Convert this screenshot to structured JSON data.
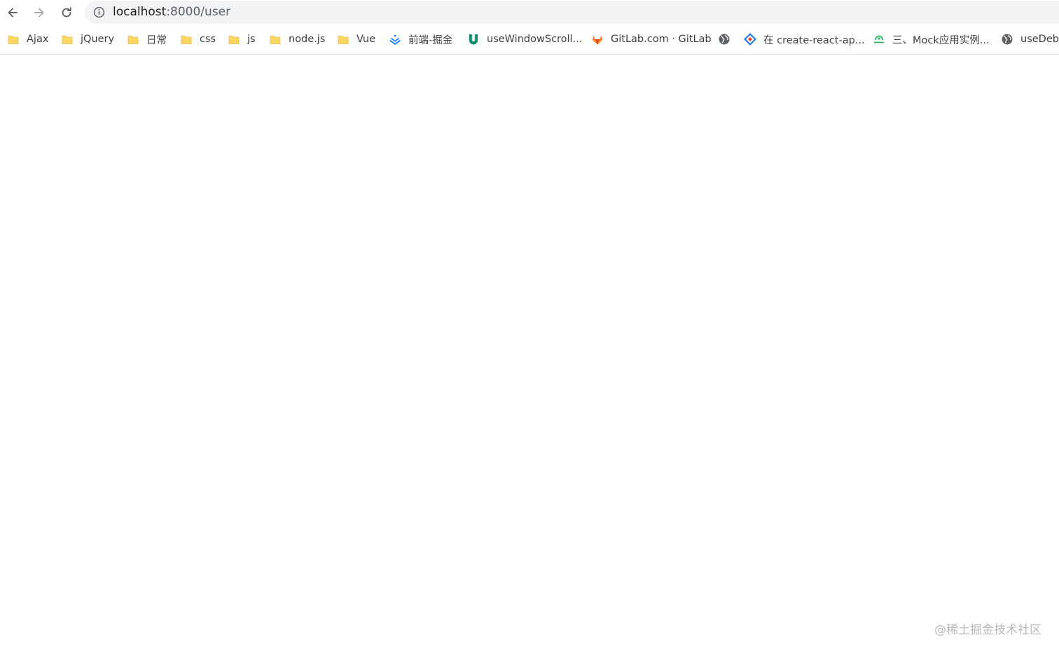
{
  "browser": {
    "address_bar": {
      "host": "localhost",
      "path": ":8000/user"
    },
    "bookmarks": [
      {
        "label": "Ajax",
        "icon": "folder-icon"
      },
      {
        "label": "jQuery",
        "icon": "folder-icon"
      },
      {
        "label": "日常",
        "icon": "folder-icon"
      },
      {
        "label": "css",
        "icon": "folder-icon"
      },
      {
        "label": "js",
        "icon": "folder-icon"
      },
      {
        "label": "node.js",
        "icon": "folder-icon"
      },
      {
        "label": "Vue",
        "icon": "folder-icon"
      },
      {
        "label": "前端-掘金",
        "icon": "juejin-icon"
      },
      {
        "label": "useWindowScroll...",
        "icon": "umi-hooks-icon"
      },
      {
        "label": "GitLab.com · GitLab",
        "icon": "gitlab-icon"
      },
      {
        "label": "",
        "icon": "globe-icon"
      },
      {
        "label": "在 create-react-ap...",
        "icon": "diamond-icon"
      },
      {
        "label": "三、Mock应用实例...",
        "icon": "mock-icon"
      },
      {
        "label": "useDebo",
        "icon": "globe-icon"
      }
    ]
  },
  "colors": {
    "folder": "#fdd663",
    "folder_stroke": "#e8b94b",
    "juejin": "#1e80ff",
    "umi": "#0c8a6e",
    "gitlab": "#fc6d26",
    "globe": "#5f6368",
    "diamond_blue": "#1a73e8",
    "diamond_red": "#ea4335",
    "mock": "#2fb15c"
  },
  "watermark": "@稀土掘金技术社区"
}
